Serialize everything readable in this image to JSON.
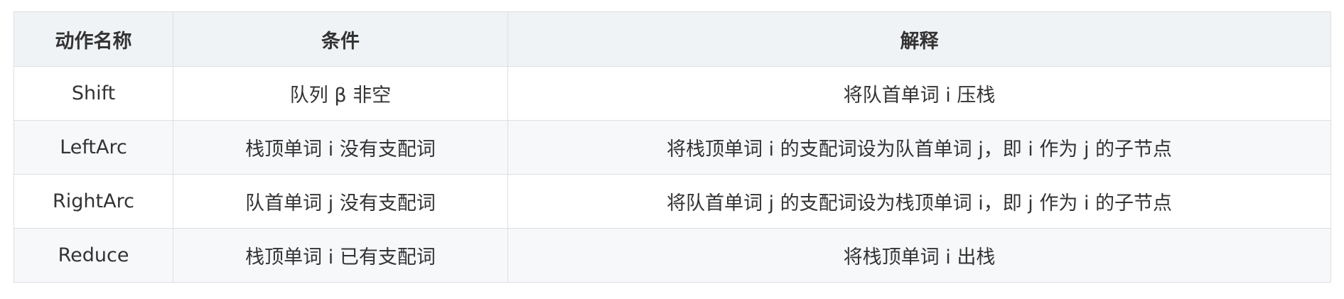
{
  "table": {
    "headers": [
      "动作名称",
      "条件",
      "解释"
    ],
    "rows": [
      [
        "Shift",
        "队列 β 非空",
        "将队首单词 i 压栈"
      ],
      [
        "LeftArc",
        "栈顶单词 i 没有支配词",
        "将栈顶单词 i 的支配词设为队首单词 j，即 i 作为 j 的子节点"
      ],
      [
        "RightArc",
        "队首单词 j 没有支配词",
        "将队首单词 j 的支配词设为栈顶单词 i，即 j 作为 i 的子节点"
      ],
      [
        "Reduce",
        "栈顶单词 i 已有支配词",
        "将栈顶单词 i 出栈"
      ]
    ]
  }
}
